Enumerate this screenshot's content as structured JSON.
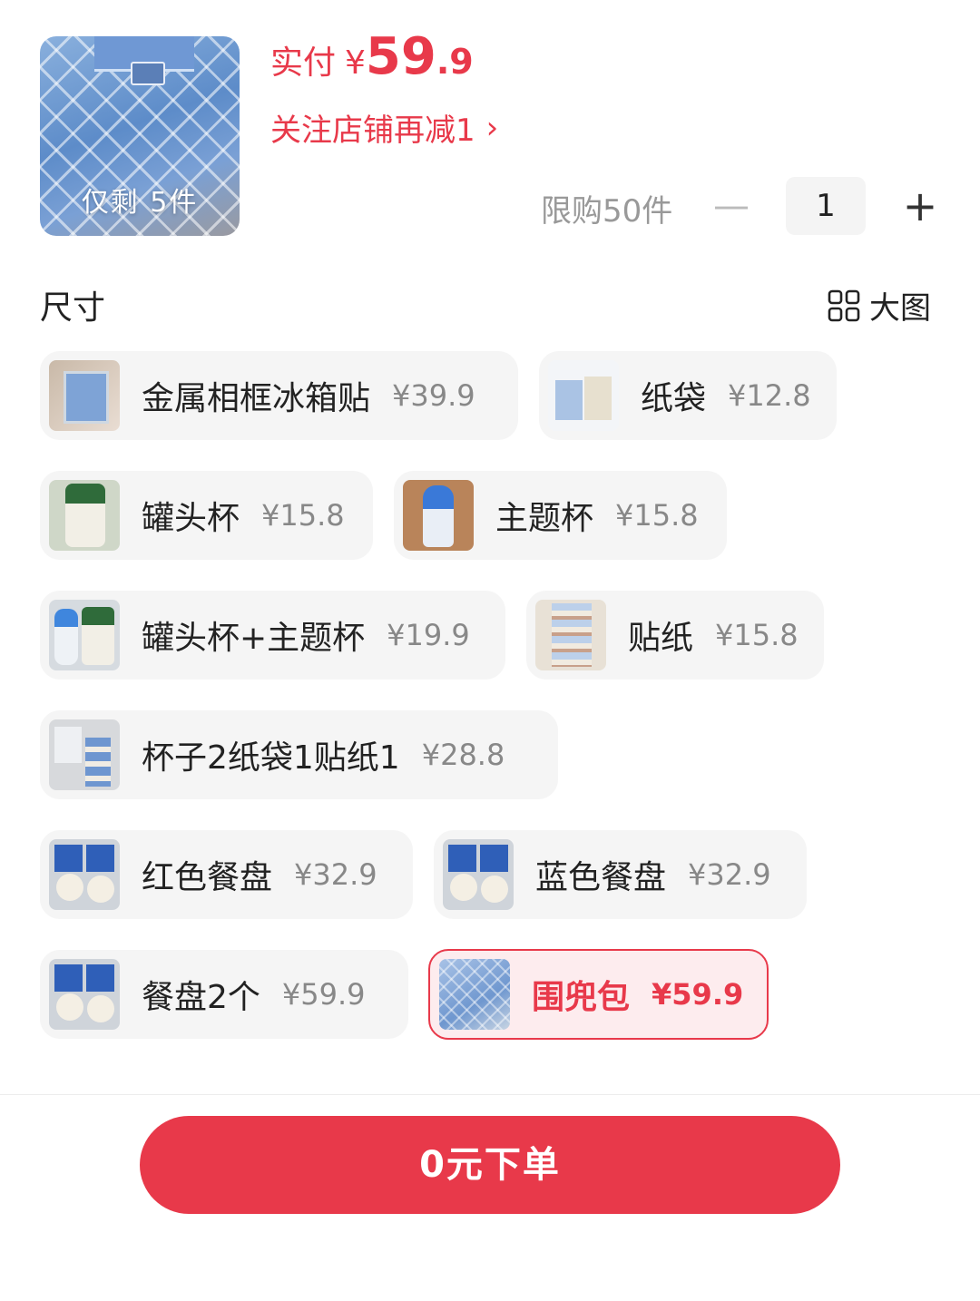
{
  "header": {
    "stock_label": "仅剩 5件",
    "price_prefix": "实付",
    "price_yen": "¥",
    "price_integer": "59",
    "price_decimal": ".9",
    "follow_text": "关注店铺再减1",
    "follow_chevron": "›",
    "limit_text": "限购50件",
    "quantity": "1",
    "minus_symbol": "—",
    "plus_symbol": "+"
  },
  "section": {
    "label": "尺寸",
    "bigview_label": "大图",
    "bigview_icon": "grid-icon"
  },
  "options": [
    {
      "name": "金属相框冰箱贴",
      "price": "¥39.9",
      "selected": false
    },
    {
      "name": "纸袋",
      "price": "¥12.8",
      "selected": false
    },
    {
      "name": "罐头杯",
      "price": "¥15.8",
      "selected": false
    },
    {
      "name": "主题杯",
      "price": "¥15.8",
      "selected": false
    },
    {
      "name": "罐头杯+主题杯",
      "price": "¥19.9",
      "selected": false
    },
    {
      "name": "贴纸",
      "price": "¥15.8",
      "selected": false
    },
    {
      "name": "杯子2纸袋1贴纸1",
      "price": "¥28.8",
      "selected": false
    },
    {
      "name": "红色餐盘",
      "price": "¥32.9",
      "selected": false
    },
    {
      "name": "蓝色餐盘",
      "price": "¥32.9",
      "selected": false
    },
    {
      "name": "餐盘2个",
      "price": "¥59.9",
      "selected": false
    },
    {
      "name": "围兜包",
      "price": "¥59.9",
      "selected": true
    }
  ],
  "footer": {
    "order_button_label": "0元下单"
  },
  "colors": {
    "accent": "#e8394a",
    "chip_background": "#f5f5f5",
    "selected_background": "#fdecee"
  }
}
